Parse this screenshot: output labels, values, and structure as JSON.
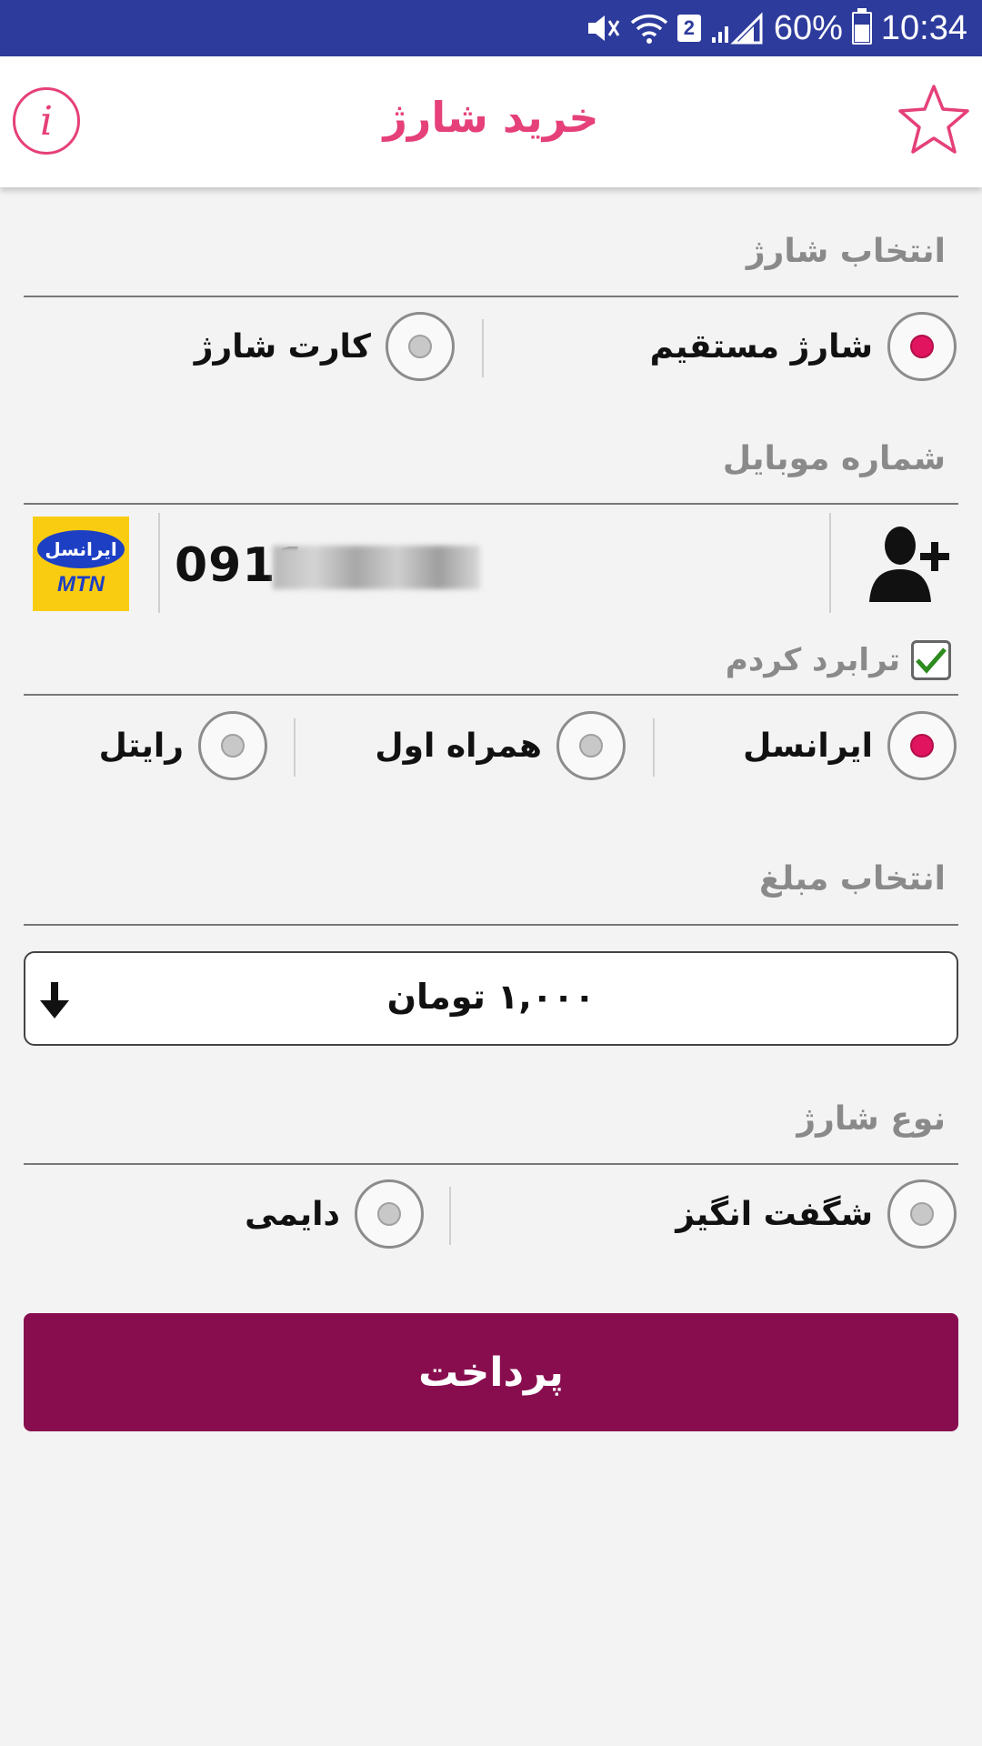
{
  "status_bar": {
    "battery_percent": "60%",
    "time": "10:34",
    "sim_slot": "2",
    "icons": [
      "mute-icon",
      "wifi-icon",
      "signal-icon",
      "battery-icon"
    ]
  },
  "app_bar": {
    "title": "خرید شارژ",
    "info_glyph": "i",
    "accent_color": "#e5407a"
  },
  "charge_selection": {
    "title": "انتخاب شارژ",
    "options": [
      {
        "label": "شارژ مستقیم",
        "checked": true
      },
      {
        "label": "کارت شارژ",
        "checked": false
      }
    ]
  },
  "mobile": {
    "title": "شماره موبایل",
    "number_visible": "0911",
    "operator_logo": {
      "top": "ایرانسل",
      "bottom": "MTN"
    },
    "ported_label": "ترابرد کردم",
    "ported_checked": true,
    "operators": [
      {
        "label": "ایرانسل",
        "checked": true
      },
      {
        "label": "همراه اول",
        "checked": false
      },
      {
        "label": "رایتل",
        "checked": false
      }
    ]
  },
  "amount": {
    "title": "انتخاب مبلغ",
    "selected": "۱,۰۰۰ تومان"
  },
  "charge_type": {
    "title": "نوع شارژ",
    "options": [
      {
        "label": "شگفت انگیز",
        "checked": false
      },
      {
        "label": "دایمی",
        "checked": false
      }
    ]
  },
  "pay_button": {
    "label": "پرداخت",
    "color": "#880d4f"
  }
}
